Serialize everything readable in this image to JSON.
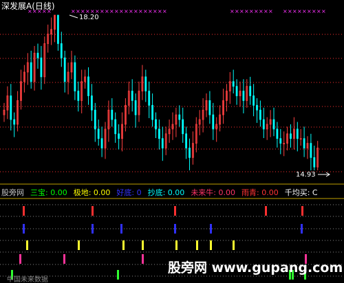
{
  "title": "深发展A(日线)",
  "price_high_label": "18.20",
  "price_low_label": "14.93",
  "indicator": {
    "name": "股旁网",
    "items": [
      {
        "label": "三宝:",
        "value": "0.00",
        "color": "#00ff00"
      },
      {
        "label": "极地:",
        "value": "0.00",
        "color": "#ffff00"
      },
      {
        "label": "好底:",
        "value": "0",
        "color": "#3333ff"
      },
      {
        "label": "抄底:",
        "value": "0.00",
        "color": "#00ffff"
      },
      {
        "label": "未来牛:",
        "value": "0.00",
        "color": "#ff3366"
      },
      {
        "label": "雨青:",
        "value": "0.00",
        "color": "#ff3333"
      },
      {
        "label": "千均买:",
        "value": "C",
        "color": "#ffffff"
      }
    ]
  },
  "watermark": "股旁网 www.gupang.com",
  "watermark_caption": "中国未来数据",
  "colors": {
    "up": "#ff4040",
    "down": "#00ffff",
    "grid": "#ff3030",
    "separator": "#c0a000",
    "marker": "#ff33ff"
  },
  "chart_data": {
    "type": "candlestick",
    "high": 18.2,
    "low": 14.93,
    "closes": [
      16.2,
      16.5,
      16.0,
      15.9,
      16.4,
      16.8,
      17.0,
      17.2,
      16.8,
      17.4,
      17.3,
      16.9,
      17.6,
      17.8,
      17.9,
      18.2,
      17.6,
      17.3,
      16.8,
      17.0,
      17.2,
      16.6,
      16.4,
      16.8,
      16.9,
      16.5,
      16.2,
      15.8,
      15.6,
      15.4,
      15.8,
      16.2,
      16.0,
      15.7,
      15.6,
      15.9,
      16.3,
      16.6,
      16.4,
      16.1,
      16.6,
      16.9,
      16.6,
      16.3,
      16.0,
      15.8,
      15.6,
      15.4,
      15.7,
      15.8,
      15.9,
      16.1,
      16.0,
      15.7,
      15.4,
      15.2,
      15.5,
      15.9,
      16.0,
      16.2,
      16.4,
      16.1,
      15.8,
      15.9,
      16.1,
      16.4,
      16.6,
      16.8,
      16.7,
      16.5,
      16.6,
      16.4,
      16.7,
      16.5,
      16.3,
      16.2,
      16.0,
      15.8,
      15.9,
      16.0,
      15.8,
      15.6,
      15.5,
      15.5,
      15.7,
      15.6,
      15.8,
      15.6,
      15.6,
      15.4,
      15.5,
      15.2,
      15.0,
      15.4
    ]
  },
  "signals": [
    {
      "row": 0,
      "color": "#ff3030",
      "x": [
        33,
        133,
        253,
        385,
        438
      ]
    },
    {
      "row": 1,
      "color": "#3030ff",
      "x": [
        33,
        133,
        175,
        253,
        305,
        437
      ]
    },
    {
      "row": 2,
      "color": "#ffff30",
      "x": [
        38,
        113,
        178,
        206,
        255,
        285,
        305,
        338
      ]
    },
    {
      "row": 3,
      "color": "#ff3399",
      "x": [
        28,
        92,
        206,
        443
      ]
    },
    {
      "row": 4,
      "color": "#30ff30",
      "x": [
        16,
        170,
        420,
        424,
        442
      ]
    }
  ]
}
